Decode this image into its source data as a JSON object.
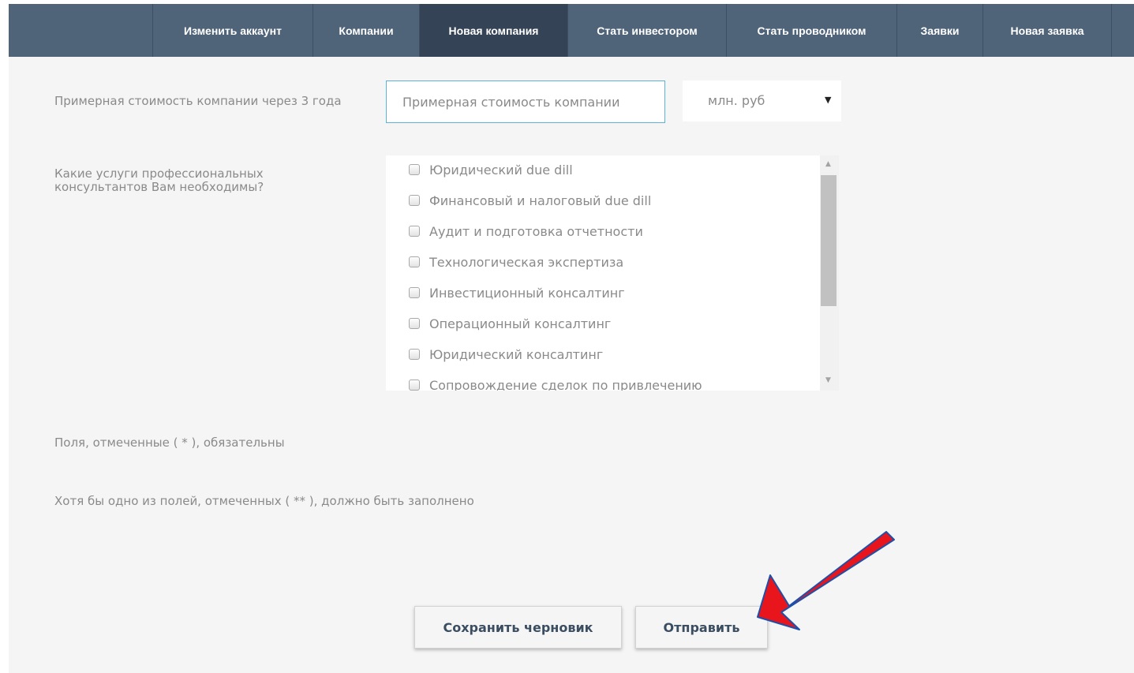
{
  "nav": {
    "items": [
      {
        "label": "Изменить аккаунт",
        "active": false
      },
      {
        "label": "Компании",
        "active": false
      },
      {
        "label": "Новая компания",
        "active": true
      },
      {
        "label": "Стать инвестором",
        "active": false
      },
      {
        "label": "Стать проводником",
        "active": false
      },
      {
        "label": "Заявки",
        "active": false
      },
      {
        "label": "Новая заявка",
        "active": false
      }
    ]
  },
  "form": {
    "valuation_label": "Примерная стоимость компании через 3 года",
    "valuation_placeholder": "Примерная стоимость компании",
    "valuation_value": "",
    "unit_selected": "млн. руб",
    "services_label": "Какие услуги профессиональных консультантов Вам необходимы?",
    "services": [
      {
        "label": "Юридический due dill",
        "checked": false
      },
      {
        "label": "Финансовый и налоговый due dill",
        "checked": false
      },
      {
        "label": "Аудит и подготовка отчетности",
        "checked": false
      },
      {
        "label": "Технологическая экспертиза",
        "checked": false
      },
      {
        "label": "Инвестиционный консалтинг",
        "checked": false
      },
      {
        "label": "Операционный консалтинг",
        "checked": false
      },
      {
        "label": "Юридический консалтинг",
        "checked": false
      },
      {
        "label": "Сопровождение сделок по привлечению",
        "checked": false
      }
    ],
    "required_note": "Поля, отмеченные ( * ), обязательны",
    "one_of_note": "Хотя бы одно из полей, отмеченных ( ** ), должно быть заполнено"
  },
  "buttons": {
    "save_draft": "Сохранить черновик",
    "submit": "Отправить"
  },
  "annotation": {
    "arrow_color": "#e8161c",
    "arrow_outline": "#1e4fa8",
    "arrow_icon": "red-arrow-icon"
  },
  "colors": {
    "navbar": "#4f6379",
    "navbar_active": "#344456",
    "input_border": "#5bb3d6"
  }
}
